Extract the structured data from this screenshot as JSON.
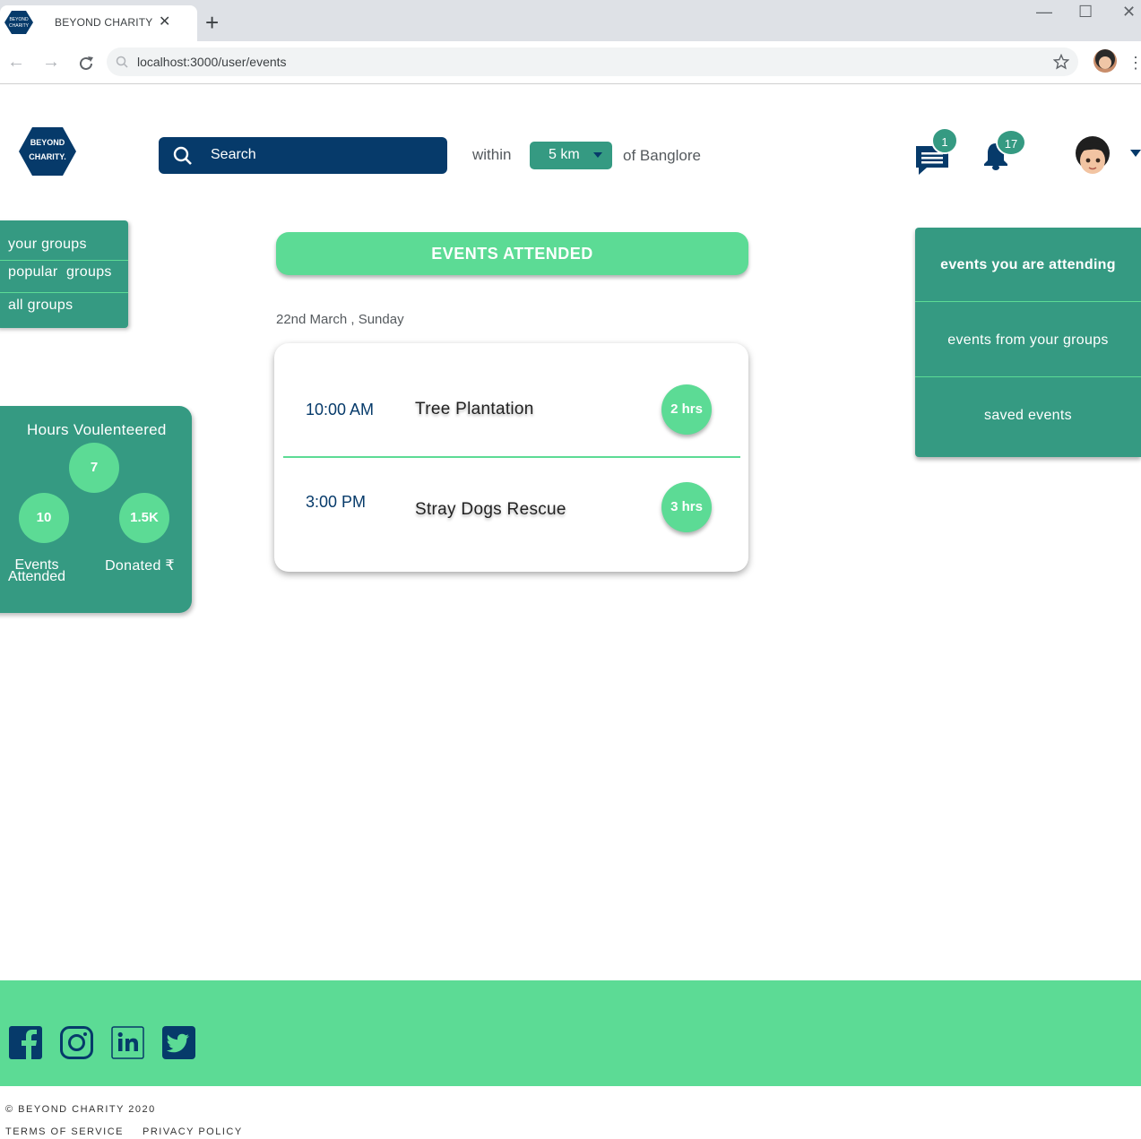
{
  "browser": {
    "tab_title": "BEYOND CHARITY",
    "tab_close": "✕",
    "new_tab": "+",
    "url": "localhost:3000/user/events",
    "minimize": "—",
    "maximize": "☐",
    "close": "✕"
  },
  "logo": {
    "line1": "BEYOND",
    "line2": "CHARITY."
  },
  "search": {
    "placeholder": "Search"
  },
  "location": {
    "within": "within",
    "radius": "5 km",
    "of_city": "of Banglore"
  },
  "notifications": {
    "messages_count": "1",
    "alerts_count": "17"
  },
  "groups_menu": {
    "items": [
      "your groups",
      "popular  groups",
      "all groups"
    ]
  },
  "stats": {
    "title": "Hours Voulenteered",
    "hours": "7",
    "events": "10",
    "donated": "1.5K",
    "events_label_1": "Events",
    "events_label_2": "Attended",
    "donated_label": "Donated ₹"
  },
  "events": {
    "header": "EVENTS ATTENDED",
    "date": "22nd March , Sunday",
    "items": [
      {
        "time": "10:00 AM",
        "name": "Tree Plantation",
        "hours": "2 hrs"
      },
      {
        "time": "3:00 PM",
        "name": "Stray Dogs Rescue",
        "hours": "3 hrs"
      }
    ]
  },
  "right_menu": {
    "items": [
      "events you are attending",
      "events from your groups",
      "saved events"
    ]
  },
  "footer": {
    "social": [
      "facebook-icon",
      "instagram-icon",
      "linkedin-icon",
      "twitter-icon"
    ],
    "copyright": "© BEYOND CHARITY 2020",
    "terms": "TERMS OF SERVICE",
    "privacy": "PRIVACY POLICY"
  },
  "colors": {
    "navy": "#063a6a",
    "teal": "#359a82",
    "mint": "#5cdb95"
  }
}
